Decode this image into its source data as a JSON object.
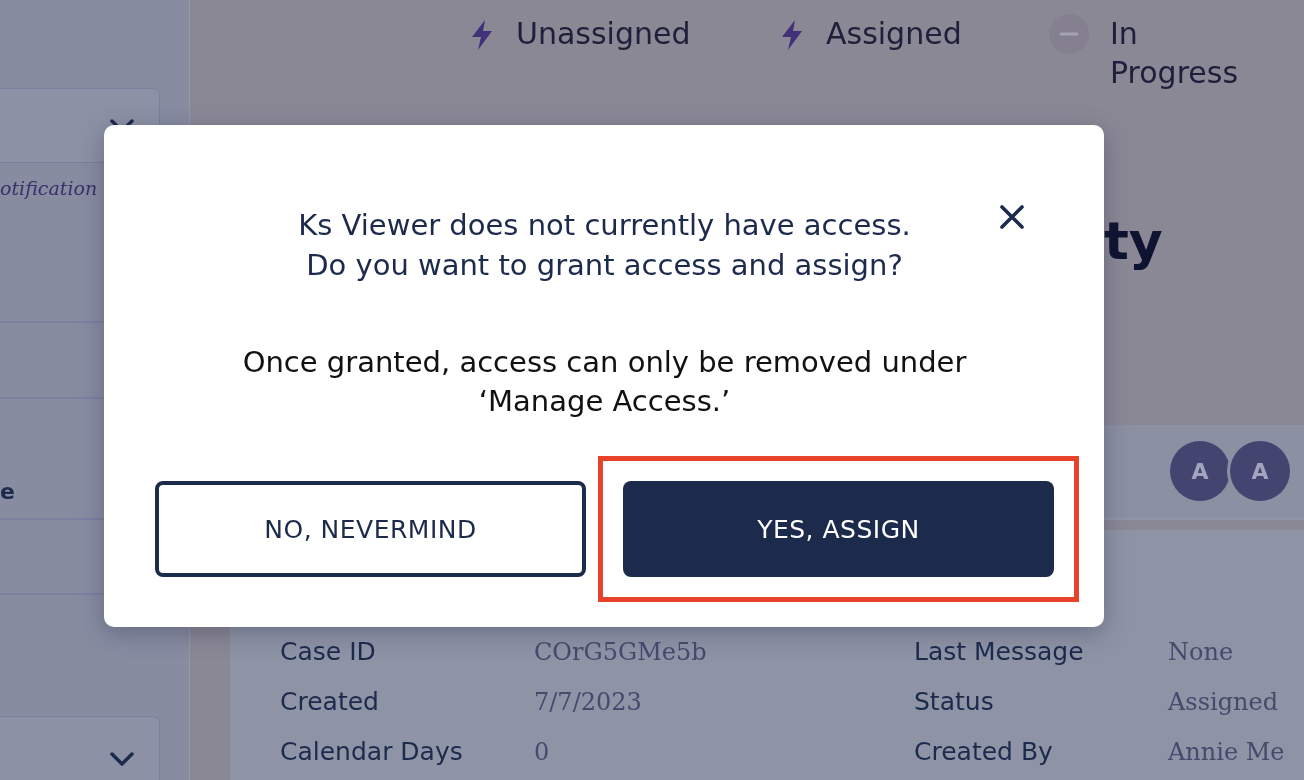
{
  "sidebar": {
    "items": [
      {
        "label": "otification",
        "kind": "note"
      },
      {
        "label": "e",
        "kind": "heading"
      }
    ]
  },
  "legend": [
    {
      "label": "Unassigned",
      "kind": "bolt"
    },
    {
      "label": "Assigned",
      "kind": "bolt"
    },
    {
      "label": "In Progress",
      "kind": "pending"
    }
  ],
  "page_title": "ty",
  "assignees": [
    {
      "initial": "A"
    },
    {
      "initial": "A"
    }
  ],
  "details": [
    {
      "label": "Case ID",
      "value": "COrG5GMe5b"
    },
    {
      "label": "Last Message",
      "value": "None"
    },
    {
      "label": "Created",
      "value": "7/7/2023"
    },
    {
      "label": "Status",
      "value": "Assigned"
    },
    {
      "label": "Calendar Days",
      "value": "0"
    },
    {
      "label": "Created By",
      "value": "Annie Me"
    }
  ],
  "modal": {
    "title": "Ks Viewer does not currently have access. Do you want to grant access and assign?",
    "message": "Once granted, access can only be removed under ‘Manage Access.’",
    "buttons": [
      {
        "label": "NO, NEVERMIND",
        "kind": "secondary",
        "highlighted": false
      },
      {
        "label": "YES, ASSIGN",
        "kind": "primary",
        "highlighted": true
      }
    ]
  }
}
